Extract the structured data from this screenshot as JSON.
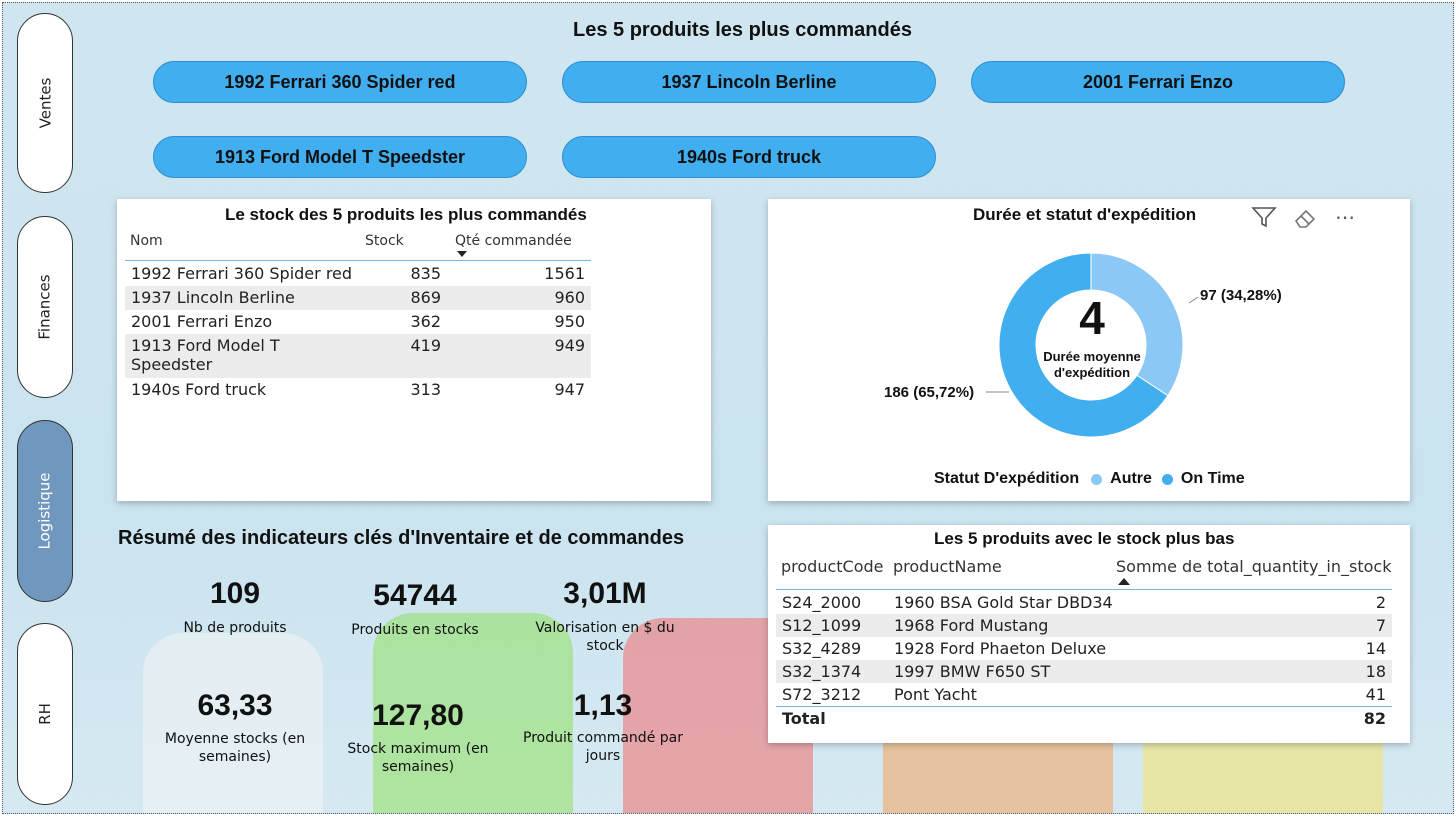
{
  "nav": {
    "ventes": "Ventes",
    "finances": "Finances",
    "logistique": "Logistique",
    "rh": "RH"
  },
  "top_products": {
    "title": "Les 5 produits les plus commandés",
    "items": [
      "1992 Ferrari 360 Spider red",
      "1937 Lincoln Berline",
      "2001 Ferrari Enzo",
      "1913 Ford Model T Speedster",
      "1940s Ford truck"
    ]
  },
  "stock_table": {
    "title": "Le stock des 5 produits les plus commandés",
    "headers": [
      "Nom",
      "Stock",
      "Qté commandée"
    ],
    "rows": [
      [
        "1992 Ferrari 360 Spider red",
        "835",
        "1561"
      ],
      [
        "1937 Lincoln Berline",
        "869",
        "960"
      ],
      [
        "2001 Ferrari Enzo",
        "362",
        "950"
      ],
      [
        "1913 Ford Model T Speedster",
        "419",
        "949"
      ],
      [
        "1940s Ford truck",
        "313",
        "947"
      ]
    ]
  },
  "shipping": {
    "title": "Durée et statut d'expédition",
    "center_value": "4",
    "center_label_1": "Durée moyenne",
    "center_label_2": "d'expédition",
    "label_autre": "97 (34,28%)",
    "label_ontime": "186 (65,72%)",
    "legend_title": "Statut D'expédition",
    "legend_autre": "Autre",
    "legend_ontime": "On Time",
    "colors": {
      "autre": "#8cc8f5",
      "ontime": "#41aef0"
    }
  },
  "chart_data": {
    "type": "pie",
    "title": "Durée et statut d'expédition",
    "categories": [
      "Autre",
      "On Time"
    ],
    "values": [
      97,
      186
    ],
    "percent": [
      34.28,
      65.72
    ],
    "legend_title": "Statut D'expédition",
    "legend_position": "bottom",
    "donut": true
  },
  "kpis": {
    "title": "Résumé des indicateurs clés d'Inventaire et de commandes",
    "items": [
      {
        "value": "109",
        "label": "Nb de produits"
      },
      {
        "value": "54744",
        "label": "Produits en stocks"
      },
      {
        "value": "3,01M",
        "label": "Valorisation en $ du stock"
      },
      {
        "value": "63,33",
        "label": "Moyenne stocks (en semaines)"
      },
      {
        "value": "127,80",
        "label": "Stock maximum (en semaines)"
      },
      {
        "value": "1,13",
        "label": "Produit commandé par jours"
      }
    ]
  },
  "low_stock": {
    "title": "Les 5 produits avec le stock plus bas",
    "headers": [
      "productCode",
      "productName",
      "Somme de total_quantity_in_stock"
    ],
    "rows": [
      [
        "S24_2000",
        "1960 BSA Gold Star DBD34",
        "2"
      ],
      [
        "S12_1099",
        "1968 Ford Mustang",
        "7"
      ],
      [
        "S32_4289",
        "1928 Ford Phaeton Deluxe",
        "14"
      ],
      [
        "S32_1374",
        "1997 BMW F650 ST",
        "18"
      ],
      [
        "S72_3212",
        "Pont Yacht",
        "41"
      ]
    ],
    "total_label": "Total",
    "total_value": "82"
  }
}
